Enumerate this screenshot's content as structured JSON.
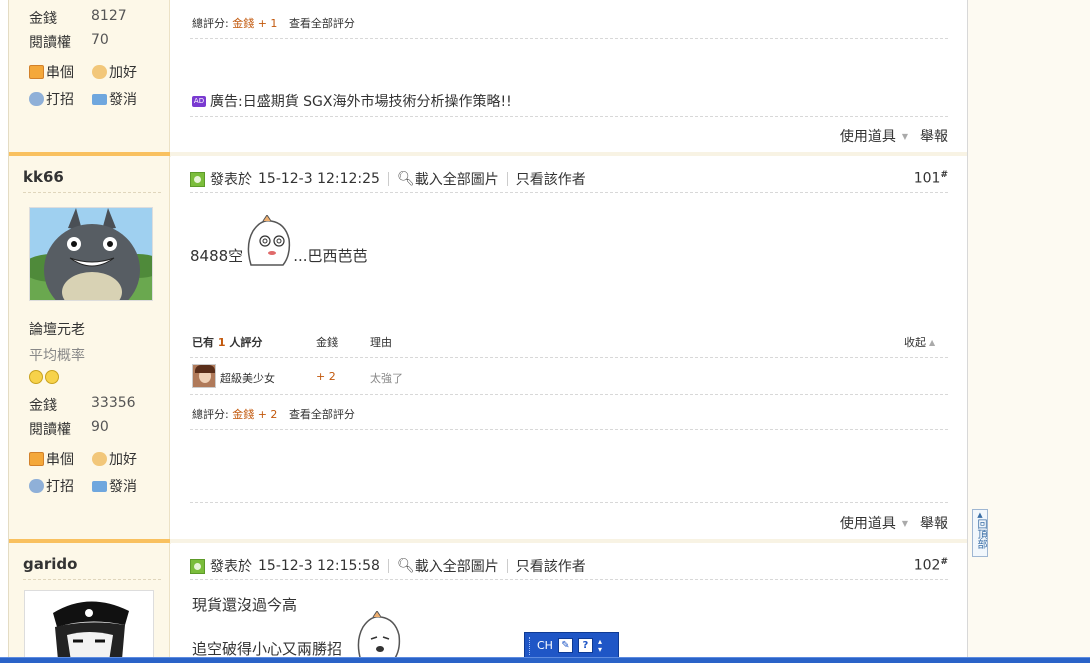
{
  "post100": {
    "stats": [
      {
        "label": "金錢",
        "value": "8127"
      },
      {
        "label": "閱讀權",
        "value": "70"
      }
    ],
    "actions": [
      "串個",
      "加好",
      "打招",
      "發消"
    ],
    "rating_total_label": "總評分:",
    "rating_total_value": "金錢 + 1",
    "view_all_ratings": "查看全部評分",
    "ad_badge": "AD",
    "ad_text": "廣告:日盛期貨 SGX海外市場技術分析操作策略!!",
    "tools_label": "使用道具",
    "report_label": "舉報"
  },
  "post101": {
    "username": "kk66",
    "rank": "論壇元老",
    "sub_rank": "平均概率",
    "stats": [
      {
        "label": "金錢",
        "value": "33356"
      },
      {
        "label": "閱讀權",
        "value": "90"
      }
    ],
    "actions": [
      "串個",
      "加好",
      "打招",
      "發消"
    ],
    "posted_label": "發表於",
    "posted_time": "15-12-3 12:12:25",
    "load_images": "載入全部圖片",
    "only_author": "只看該作者",
    "floor": "101",
    "floor_mark": "#",
    "content_before": "8488空",
    "content_after": "...巴西芭芭",
    "rate_header_prefix": "已有",
    "rate_header_count": "1",
    "rate_header_suffix": "人評分",
    "rate_col_money": "金錢",
    "rate_col_reason": "理由",
    "rate_collapse": "收起",
    "rater_name": "超級美少女",
    "rater_money": "+ 2",
    "rater_reason": "太強了",
    "rating_total_label": "總評分:",
    "rating_total_value": "金錢 + 2",
    "view_all_ratings": "查看全部評分",
    "tools_label": "使用道具",
    "report_label": "舉報"
  },
  "post102": {
    "username": "garido",
    "posted_label": "發表於",
    "posted_time": "15-12-3 12:15:58",
    "load_images": "載入全部圖片",
    "only_author": "只看該作者",
    "floor": "102",
    "floor_mark": "#",
    "content_line1": "現貨還沒過今高",
    "content_line2": "追空破得小心又兩勝招"
  },
  "gotop_label": "回頂部",
  "ime": {
    "lang": "CH",
    "help": "?"
  },
  "colors": {
    "accent_orange": "#f9c15f",
    "money_red": "#c2580c",
    "side_bg": "#fdf8e8"
  }
}
